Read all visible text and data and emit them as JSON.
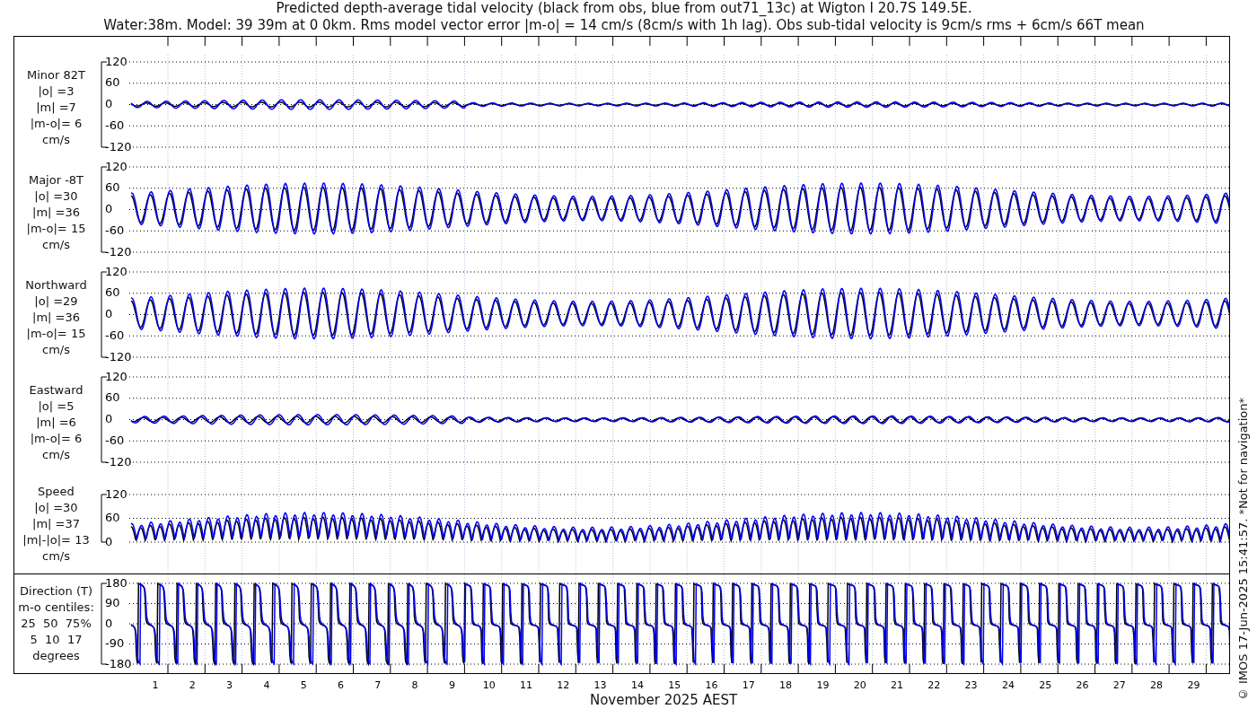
{
  "title": {
    "lines": [
      "Predicted depth-average tidal velocity (black from obs, blue from out71_13c) at Wigton I 20.7S 149.5E.",
      "Water:38m. Model: 39 39m at 0 0km. Rms model vector error |m-o| = 14 cm/s (8cm/s with 1h lag). Obs sub-tidal velocity is 9cm/s rms + 6cm/s 66T mean"
    ]
  },
  "panels": [
    {
      "kind": "minor",
      "label_lines": [
        "Minor 82T",
        "|o| =3",
        "|m| =7",
        "|m-o|= 6",
        "cm/s"
      ],
      "yticks": [
        "120",
        "60",
        "0",
        "-60",
        "-120"
      ]
    },
    {
      "kind": "major",
      "label_lines": [
        "Major -8T",
        "|o| =30",
        "|m| =36",
        "|m-o|= 15",
        "cm/s"
      ],
      "yticks": [
        "120",
        "60",
        "0",
        "-60",
        "-120"
      ]
    },
    {
      "kind": "northward",
      "label_lines": [
        "Northward",
        "|o| =29",
        "|m| =36",
        "|m-o|= 15",
        "cm/s"
      ],
      "yticks": [
        "120",
        "60",
        "0",
        "-60",
        "-120"
      ]
    },
    {
      "kind": "eastward",
      "label_lines": [
        "Eastward",
        "|o| =5",
        "|m| =6",
        "|m-o|= 6",
        "cm/s"
      ],
      "yticks": [
        "120",
        "60",
        "0",
        "-60",
        "-120"
      ]
    },
    {
      "kind": "speed",
      "label_lines": [
        "Speed",
        "|o| =30",
        "|m| =37",
        "|m|-|o|= 13",
        "cm/s"
      ],
      "yticks": [
        "120",
        "60",
        "0"
      ]
    },
    {
      "kind": "direction",
      "label_lines": [
        "Direction (T)",
        "m-o centiles:",
        "25  50  75%",
        "5  10  17",
        "degrees"
      ],
      "yticks": [
        "180",
        "90",
        "0",
        "-90",
        "-180"
      ]
    }
  ],
  "x_axis": {
    "ticks": [
      "1",
      "2",
      "3",
      "4",
      "5",
      "6",
      "7",
      "8",
      "9",
      "10",
      "11",
      "12",
      "13",
      "14",
      "15",
      "16",
      "17",
      "18",
      "19",
      "20",
      "21",
      "22",
      "23",
      "24",
      "25",
      "26",
      "27",
      "28",
      "29"
    ],
    "label": "November 2025 AEST"
  },
  "footer": "© IMOS 17-Jun-2025 15:41:57. *Not for navigation*"
}
